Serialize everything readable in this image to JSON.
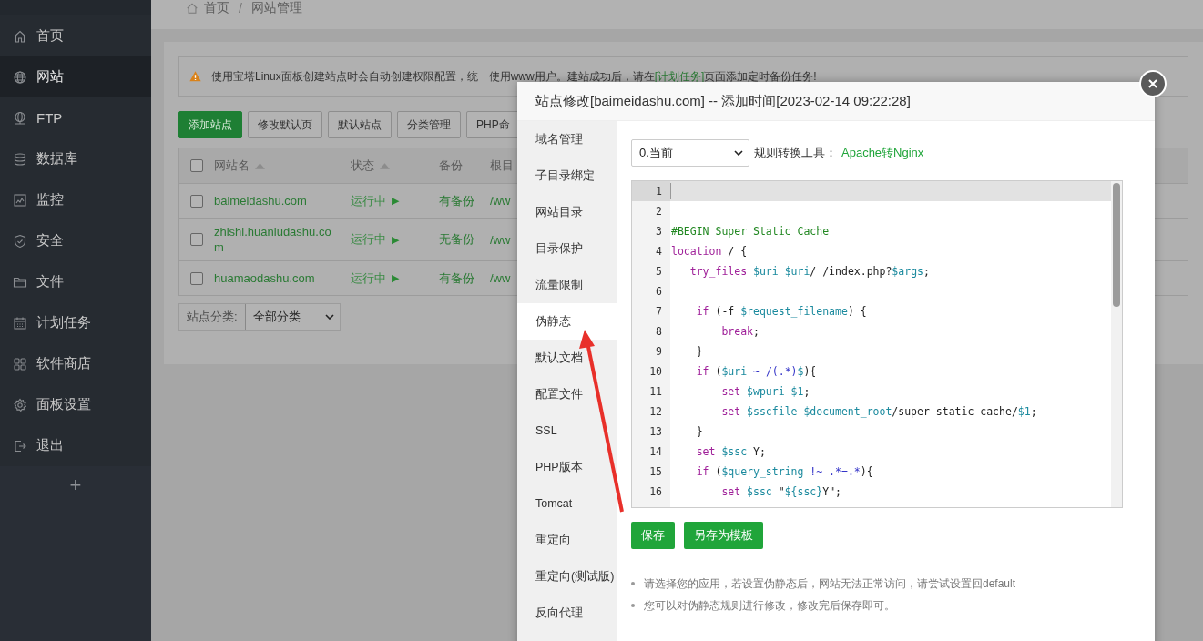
{
  "breadcrumb": {
    "home": "首页",
    "separator": "/",
    "current": "网站管理"
  },
  "sidebar": {
    "items": [
      {
        "label": "首页",
        "selected": false
      },
      {
        "label": "网站",
        "selected": true
      },
      {
        "label": "FTP",
        "selected": false
      },
      {
        "label": "数据库",
        "selected": false
      },
      {
        "label": "监控",
        "selected": false
      },
      {
        "label": "安全",
        "selected": false
      },
      {
        "label": "文件",
        "selected": false
      },
      {
        "label": "计划任务",
        "selected": false
      },
      {
        "label": "软件商店",
        "selected": false
      },
      {
        "label": "面板设置",
        "selected": false
      },
      {
        "label": "退出",
        "selected": false
      }
    ],
    "add": "+"
  },
  "notice": {
    "text": "使用宝塔Linux面板创建站点时会自动创建权限配置，统一使用www用户。建站成功后，请在",
    "link": "[计划任务]",
    "after": "页面添加定时备份任务!"
  },
  "toolbar": [
    {
      "label": "添加站点",
      "kind": "primary"
    },
    {
      "label": "修改默认页",
      "kind": "default"
    },
    {
      "label": "默认站点",
      "kind": "default"
    },
    {
      "label": "分类管理",
      "kind": "default"
    },
    {
      "label": "PHP命",
      "kind": "default"
    }
  ],
  "table": {
    "select_all": {
      "checked": false
    },
    "columns": [
      {
        "label": "网站名",
        "sorted": true
      },
      {
        "label": "状态",
        "sorted": true
      },
      {
        "label": "备份",
        "sorted": false
      },
      {
        "label": "根目",
        "sorted": false
      }
    ],
    "rows": [
      {
        "checked": false,
        "name": "baimeidashu.com",
        "status": "运行中",
        "status_icon": "▶",
        "backup": "有备份",
        "path": "/ww"
      },
      {
        "checked": false,
        "name": "zhishi.huaniudashu.com",
        "status": "运行中",
        "status_icon": "▶",
        "backup": "无备份",
        "path": "/ww"
      },
      {
        "checked": false,
        "name": "huamaodashu.com",
        "status": "运行中",
        "status_icon": "▶",
        "backup": "有备份",
        "path": "/ww"
      }
    ]
  },
  "filter": {
    "label": "站点分类:",
    "value": "全部分类"
  },
  "dialog": {
    "title": "站点修改[baimeidashu.com] -- 添加时间[2023-02-14 09:22:28]",
    "tabs": [
      {
        "label": "域名管理",
        "selected": false
      },
      {
        "label": "子目录绑定",
        "selected": false
      },
      {
        "label": "网站目录",
        "selected": false
      },
      {
        "label": "目录保护",
        "selected": false
      },
      {
        "label": "流量限制",
        "selected": false
      },
      {
        "label": "伪静态",
        "selected": true
      },
      {
        "label": "默认文档",
        "selected": false
      },
      {
        "label": "配置文件",
        "selected": false
      },
      {
        "label": "SSL",
        "selected": false
      },
      {
        "label": "PHP版本",
        "selected": false
      },
      {
        "label": "Tomcat",
        "selected": false
      },
      {
        "label": "重定向",
        "selected": false
      },
      {
        "label": "重定向(测试版)",
        "selected": false
      },
      {
        "label": "反向代理",
        "selected": false
      }
    ],
    "template_select": "0.当前",
    "tool_label": "规则转换工具：",
    "tool_link": "Apache转Nginx",
    "code": [
      {
        "number": "1",
        "active": true
      },
      {
        "number": "2",
        "active": false
      },
      {
        "number": "3",
        "active": false,
        "tokens": [
          {
            "kind": "comment",
            "text": "#BEGIN Super Static Cache"
          }
        ]
      },
      {
        "number": "4",
        "active": false,
        "tokens": [
          {
            "kind": "keyword",
            "text": "location"
          },
          {
            "kind": "plain",
            "text": " / {"
          }
        ]
      },
      {
        "number": "5",
        "active": false,
        "tokens": [
          {
            "kind": "keyword",
            "text": "   try_files"
          },
          {
            "kind": "variable",
            "text": " $uri"
          },
          {
            "kind": "variable",
            "text": " $uri"
          },
          {
            "kind": "plain",
            "text": "/ /index.php?"
          },
          {
            "kind": "variable",
            "text": "$args"
          },
          {
            "kind": "plain",
            "text": ";"
          }
        ]
      },
      {
        "number": "6",
        "active": false
      },
      {
        "number": "7",
        "active": false,
        "tokens": [
          {
            "kind": "keyword",
            "text": "    if"
          },
          {
            "kind": "plain",
            "text": " (-f "
          },
          {
            "kind": "variable",
            "text": "$request_filename"
          },
          {
            "kind": "plain",
            "text": ") {"
          }
        ]
      },
      {
        "number": "8",
        "active": false,
        "tokens": [
          {
            "kind": "keyword",
            "text": "        break"
          },
          {
            "kind": "plain",
            "text": ";"
          }
        ]
      },
      {
        "number": "9",
        "active": false,
        "tokens": [
          {
            "kind": "plain",
            "text": "    }"
          }
        ]
      },
      {
        "number": "10",
        "active": false,
        "tokens": [
          {
            "kind": "keyword",
            "text": "    if"
          },
          {
            "kind": "plain",
            "text": " ("
          },
          {
            "kind": "variable",
            "text": "$uri"
          },
          {
            "kind": "regex",
            "text": " ~ /(.*)"
          },
          {
            "kind": "variable",
            "text": "$"
          },
          {
            "kind": "plain",
            "text": "){"
          }
        ]
      },
      {
        "number": "11",
        "active": false,
        "tokens": [
          {
            "kind": "keyword",
            "text": "        set"
          },
          {
            "kind": "variable",
            "text": " $wpuri"
          },
          {
            "kind": "variable",
            "text": " $1"
          },
          {
            "kind": "plain",
            "text": ";"
          }
        ]
      },
      {
        "number": "12",
        "active": false,
        "tokens": [
          {
            "kind": "keyword",
            "text": "        set"
          },
          {
            "kind": "variable",
            "text": " $sscfile"
          },
          {
            "kind": "variable",
            "text": " $document_root"
          },
          {
            "kind": "plain",
            "text": "/super-static-cache/"
          },
          {
            "kind": "variable",
            "text": "$1"
          },
          {
            "kind": "plain",
            "text": ";"
          }
        ]
      },
      {
        "number": "13",
        "active": false,
        "tokens": [
          {
            "kind": "plain",
            "text": "    }"
          }
        ]
      },
      {
        "number": "14",
        "active": false,
        "tokens": [
          {
            "kind": "keyword",
            "text": "    set"
          },
          {
            "kind": "variable",
            "text": " $ssc"
          },
          {
            "kind": "plain",
            "text": " Y;"
          }
        ]
      },
      {
        "number": "15",
        "active": false,
        "tokens": [
          {
            "kind": "keyword",
            "text": "    if"
          },
          {
            "kind": "plain",
            "text": " ("
          },
          {
            "kind": "variable",
            "text": "$query_string"
          },
          {
            "kind": "regex",
            "text": " !~ .*=.*"
          },
          {
            "kind": "plain",
            "text": "){"
          }
        ]
      },
      {
        "number": "16",
        "active": false,
        "tokens": [
          {
            "kind": "keyword",
            "text": "        set"
          },
          {
            "kind": "variable",
            "text": " $ssc"
          },
          {
            "kind": "plain",
            "text": " \""
          },
          {
            "kind": "variable",
            "text": "${ssc}"
          },
          {
            "kind": "plain",
            "text": "Y\";"
          }
        ]
      }
    ],
    "buttons": [
      "保存",
      "另存为模板"
    ],
    "notes": [
      "请选择您的应用，若设置伪静态后，网站无法正常访问，请尝试设置回default",
      "您可以对伪静态规则进行修改，修改完后保存即可。"
    ]
  }
}
